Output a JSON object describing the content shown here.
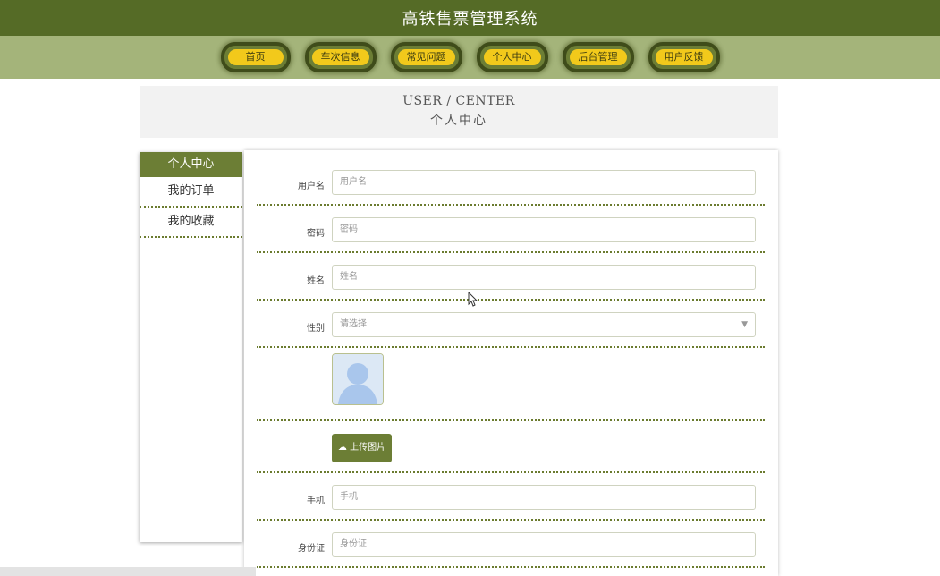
{
  "header": {
    "title": "高铁售票管理系统"
  },
  "nav": {
    "items": [
      {
        "label": "首页"
      },
      {
        "label": "车次信息"
      },
      {
        "label": "常见问题"
      },
      {
        "label": "个人中心"
      },
      {
        "label": "后台管理"
      },
      {
        "label": "用户反馈"
      }
    ]
  },
  "page_head": {
    "en": "USER / CENTER",
    "cn": "个人中心"
  },
  "sidebar": {
    "items": [
      {
        "label": "个人中心",
        "active": true
      },
      {
        "label": "我的订单"
      },
      {
        "label": "我的收藏"
      }
    ]
  },
  "form": {
    "username": {
      "label": "用户名",
      "placeholder": "用户名"
    },
    "password": {
      "label": "密码",
      "placeholder": "密码"
    },
    "name": {
      "label": "姓名",
      "placeholder": "姓名"
    },
    "gender": {
      "label": "性别",
      "placeholder": "请选择"
    },
    "upload_label": "上传图片",
    "phone": {
      "label": "手机",
      "placeholder": "手机"
    },
    "id_card": {
      "label": "身份证",
      "placeholder": "身份证"
    }
  },
  "colors": {
    "header_bg": "#556b26",
    "nav_bg": "#a4b47a",
    "nav_pill": "#f2c91b",
    "accent": "#6c7e35"
  },
  "icons": {
    "upload": "cloud-upload-icon",
    "avatar": "user-avatar-icon",
    "select": "chevron-down-icon",
    "cursor": "mouse-pointer-icon"
  }
}
